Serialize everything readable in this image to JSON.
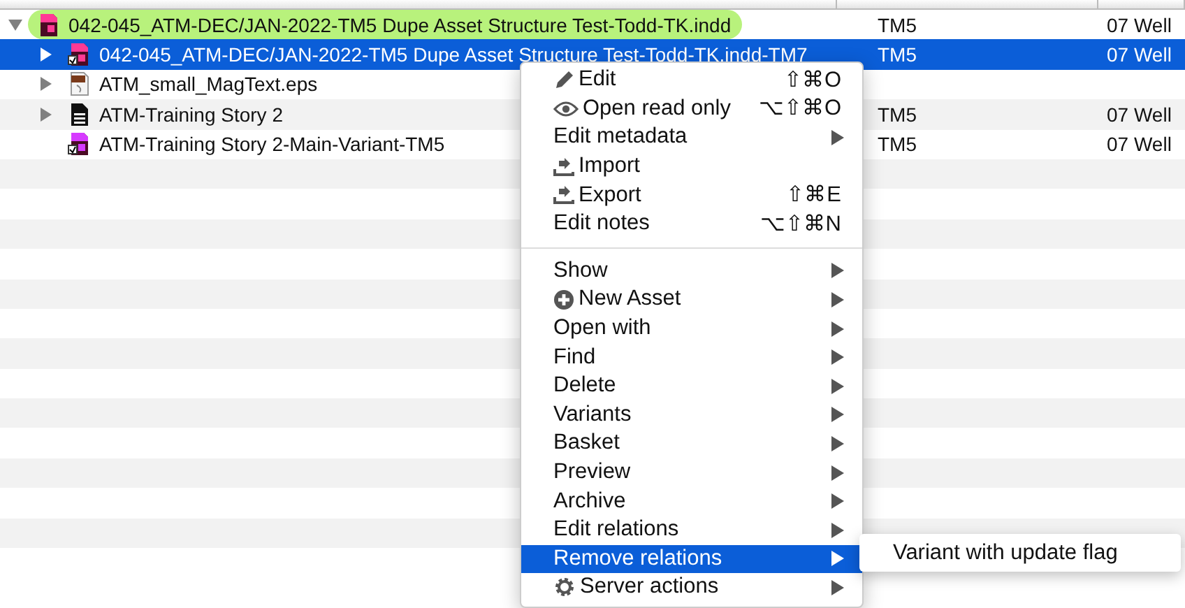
{
  "table": {
    "rows": [
      {
        "name": "042-045_ATM-DEC/JAN-2022-TM5 Dupe Asset Structure Test-Todd-TK.indd",
        "edition": "TM5",
        "section": "07 Well",
        "expanded": true,
        "kind": "layout",
        "selected": false,
        "color": "#b8f27c",
        "children": [
          {
            "name": "042-045_ATM-DEC/JAN-2022-TM5 Dupe Asset Structure Test-Todd-TK.indd-TM7",
            "edition": "TM5",
            "section": "07 Well",
            "expanded": false,
            "kind": "layoutvariant",
            "selected": true
          },
          {
            "name": "ATM_small_MagText.eps",
            "expanded": false,
            "kind": "image",
            "selected": false
          },
          {
            "name": "ATM-Training Story 2",
            "edition": "TM5",
            "section": "07 Well",
            "expanded": false,
            "kind": "text",
            "selected": false
          },
          {
            "name": "ATM-Training Story 2-Main-Variant-TM5",
            "edition": "TM5",
            "section": "07 Well",
            "kind": "storyvariant",
            "selected": false
          }
        ]
      }
    ]
  },
  "context_menu": {
    "sections": [
      [
        {
          "label": "Edit",
          "shortcut": "⇧⌘O",
          "submenu": false,
          "selected": false
        },
        {
          "label": "Open read only",
          "shortcut": "⌥⇧⌘O",
          "submenu": false,
          "selected": false
        },
        {
          "label": "Edit metadata",
          "submenu": true,
          "selected": false
        },
        {
          "label": "Import",
          "submenu": false,
          "selected": false
        },
        {
          "label": "Export",
          "shortcut": "⇧⌘E",
          "submenu": false,
          "selected": false
        },
        {
          "label": "Edit notes",
          "shortcut": "⌥⇧⌘N",
          "submenu": false,
          "selected": false
        }
      ],
      [
        {
          "label": "Show",
          "submenu": true,
          "selected": false
        },
        {
          "label": "New Asset",
          "submenu": true,
          "selected": false
        },
        {
          "label": "Open with",
          "submenu": true,
          "selected": false
        },
        {
          "label": "Find",
          "submenu": true,
          "selected": false
        },
        {
          "label": "Delete",
          "submenu": true,
          "selected": false
        },
        {
          "label": "Variants",
          "submenu": true,
          "selected": false
        },
        {
          "label": "Basket",
          "submenu": true,
          "selected": false
        },
        {
          "label": "Preview",
          "submenu": true,
          "selected": false
        },
        {
          "label": "Archive",
          "submenu": true,
          "selected": false
        },
        {
          "label": "Edit relations",
          "submenu": true,
          "selected": false
        },
        {
          "label": "Remove relations",
          "submenu": true,
          "selected": true
        },
        {
          "label": "Server actions",
          "submenu": true,
          "selected": false
        }
      ]
    ],
    "submenu": {
      "items": [
        "Variant with update flag"
      ]
    }
  }
}
